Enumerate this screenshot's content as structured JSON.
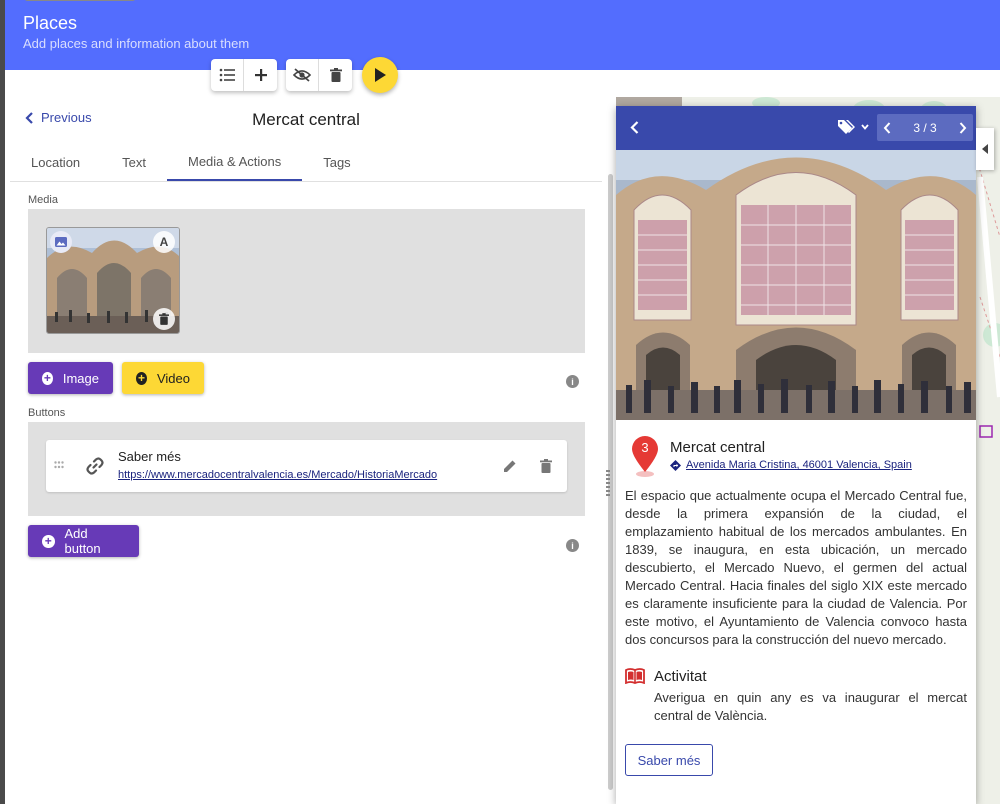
{
  "header": {
    "title": "Places",
    "subtitle": "Add places and information about them"
  },
  "toolbar": {
    "list_icon": "list-icon",
    "add_icon": "plus-icon",
    "hide_icon": "eye-off-icon",
    "delete_icon": "trash-icon",
    "play_icon": "play-icon"
  },
  "editor": {
    "previous_label": "Previous",
    "place_title": "Mercat central",
    "tabs": [
      {
        "label": "Location",
        "active": false
      },
      {
        "label": "Text",
        "active": false
      },
      {
        "label": "Media & Actions",
        "active": true
      },
      {
        "label": "Tags",
        "active": false
      }
    ],
    "media_label": "Media",
    "media_chip_letter": "A",
    "image_button": "Image",
    "video_button": "Video",
    "buttons_label": "Buttons",
    "button_item": {
      "name": "Saber més",
      "url": "https://www.mercadocentralvalencia.es/Mercado/HistoriaMercado"
    },
    "add_button_label": "Add button"
  },
  "preview": {
    "pager": "3 / 3",
    "marker_number": "3",
    "title": "Mercat central",
    "address": "Avenida Maria Cristina, 46001 Valencia, Spain",
    "description": "El espacio que actualmente ocupa el Mercado Central fue, desde la primera expansión de la ciudad, el emplazamiento habitual de los mercados ambulantes. En 1839, se inaugura, en esta ubicación, un mercado descubierto, el Mercado Nuevo, el germen del actual Mercado Central. Hacia finales del siglo XIX este mercado es claramente insuficiente para la ciudad de Valencia. Por este motivo, el Ayuntamiento de Valencia convoco hasta dos concursos para la construcción del nuevo mercado.",
    "activity_title": "Activitat",
    "activity_text": "Averigua en quin any es va inaugurar el mercat central de València.",
    "button_label": "Saber més"
  },
  "colors": {
    "header": "#536dfe",
    "panel_bar": "#3949ab",
    "accent_purple": "#673ab7",
    "accent_yellow": "#fdd835",
    "marker_red": "#e53935"
  }
}
